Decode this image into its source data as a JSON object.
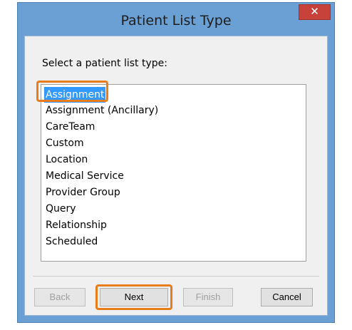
{
  "window": {
    "title": "Patient List Type",
    "close_label": "✕"
  },
  "prompt": "Select a patient list type:",
  "list": {
    "items": [
      "Assignment",
      "Assignment (Ancillary)",
      "CareTeam",
      "Custom",
      "Location",
      "Medical Service",
      "Provider Group",
      "Query",
      "Relationship",
      "Scheduled"
    ],
    "selected": "Assignment"
  },
  "buttons": {
    "back": "Back",
    "next": "Next",
    "finish": "Finish",
    "cancel": "Cancel"
  },
  "colors": {
    "frame": "#6aa0d4",
    "selection": "#3399ff",
    "highlight": "#e87d1e",
    "close": "#c7423a"
  }
}
